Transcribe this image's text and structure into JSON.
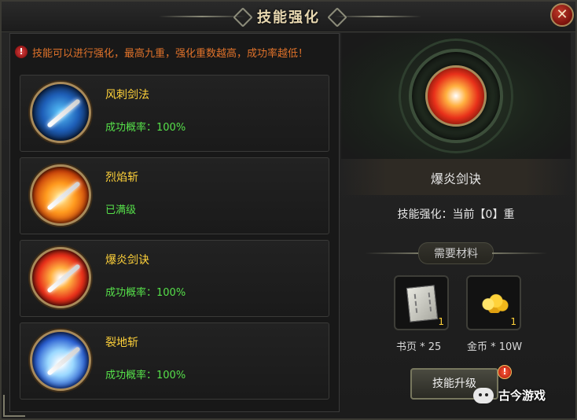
{
  "window": {
    "title": "技能强化",
    "close_glyph": "✕"
  },
  "notice": {
    "icon_glyph": "!",
    "text": "技能可以进行强化，最高九重，强化重数越高，成功率越低！"
  },
  "skills": [
    {
      "name": "风刺剑法",
      "status": "成功概率：100%",
      "icon": "wind-sword-icon"
    },
    {
      "name": "烈焰斩",
      "status": "已满级",
      "icon": "flame-slash-icon"
    },
    {
      "name": "爆炎剑诀",
      "status": "成功概率：100%",
      "icon": "burst-flame-sword-icon"
    },
    {
      "name": "裂地斩",
      "status": "成功概率：100%",
      "icon": "ground-split-icon"
    }
  ],
  "selected": {
    "name": "爆炎剑诀",
    "level_text": "技能强化：当前【0】重"
  },
  "materials": {
    "header": "需要材料",
    "items": [
      {
        "label": "书页 * 25",
        "count": "1",
        "icon": "book-page-icon"
      },
      {
        "label": "金币 * 10W",
        "count": "1",
        "icon": "gold-coin-icon"
      }
    ]
  },
  "upgrade": {
    "label": "技能升级",
    "alert_glyph": "!"
  },
  "watermark": {
    "text": "古今游戏"
  },
  "colors": {
    "gold_text": "#ffd23a",
    "green_text": "#56e04a",
    "warning_text": "#e0722a"
  }
}
